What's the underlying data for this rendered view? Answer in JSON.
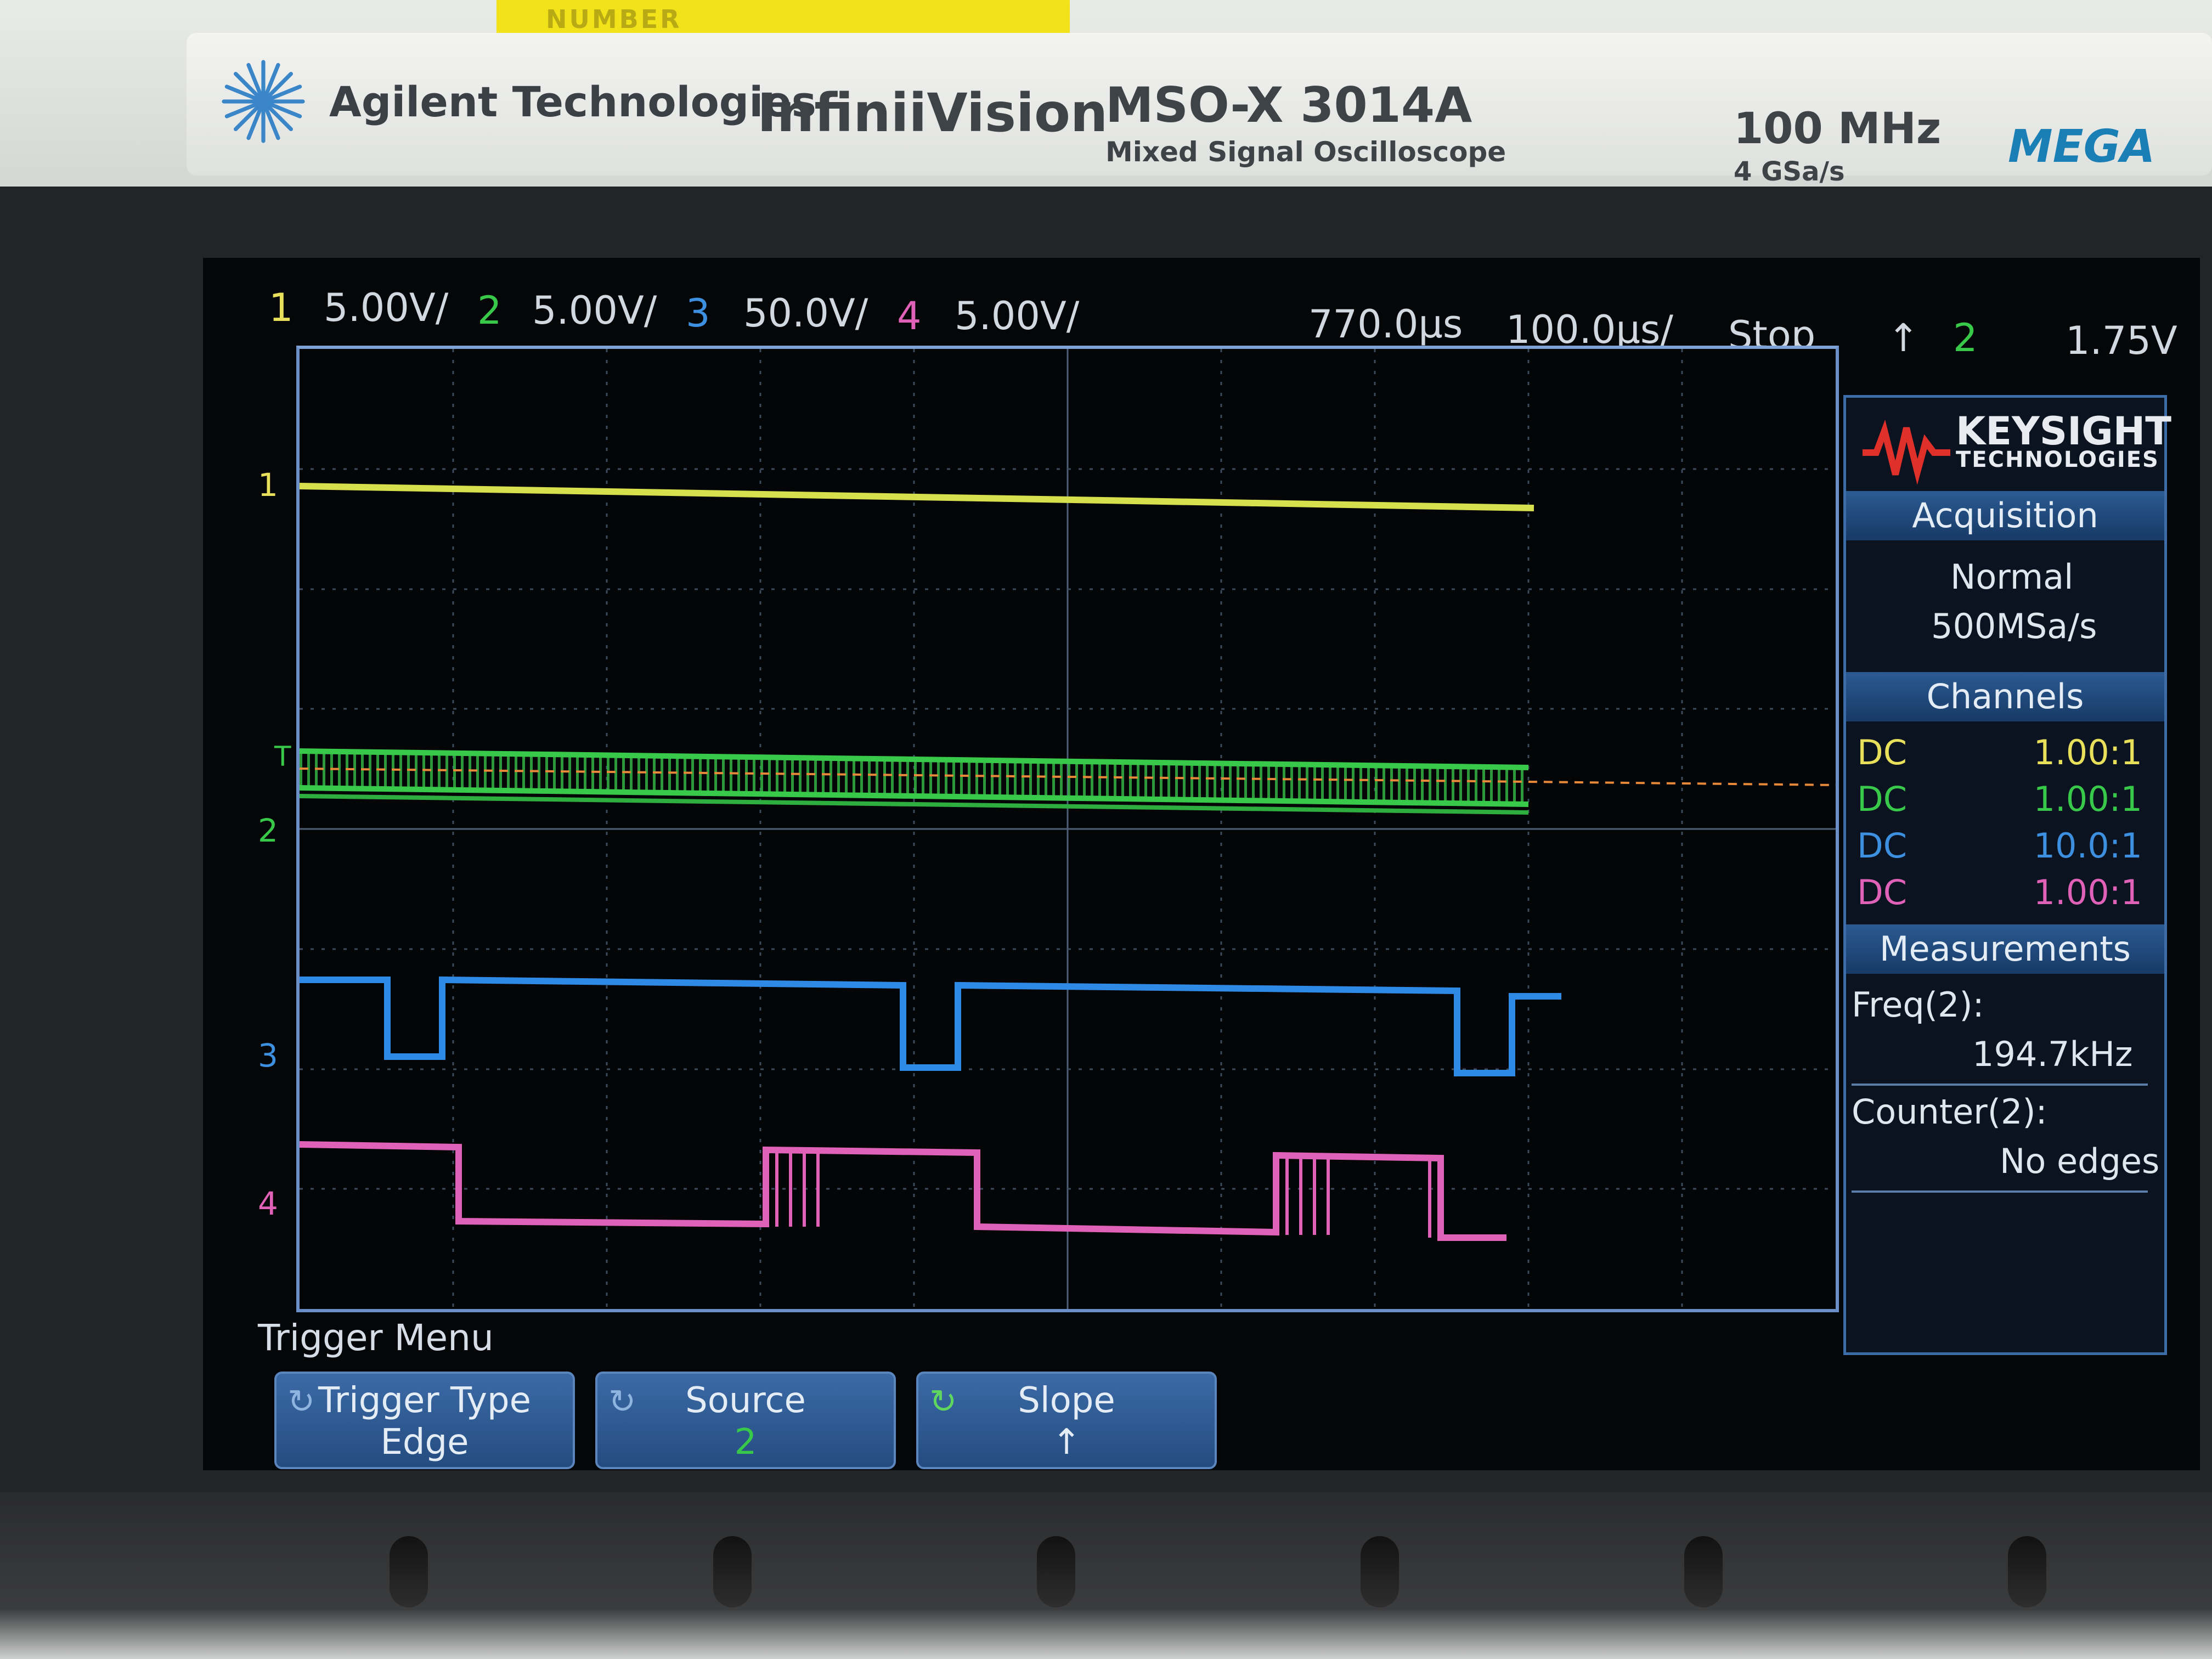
{
  "instrument": {
    "sticker_text": "NUMBER",
    "brand": "Agilent Technologies",
    "series": "InfiniiVision",
    "model": "MSO-X 3014A",
    "model_subtitle": "Mixed Signal Oscilloscope",
    "bandwidth": "100 MHz",
    "sample_rate": "4 GSa/s",
    "badge": "MEGA"
  },
  "status_bar": {
    "channels": [
      {
        "num": "1",
        "scale": "5.00V/",
        "color": "#e8e05a"
      },
      {
        "num": "2",
        "scale": "5.00V/",
        "color": "#39c94a"
      },
      {
        "num": "3",
        "scale": "50.0V/",
        "color": "#3d8fe0"
      },
      {
        "num": "4",
        "scale": "5.00V/",
        "color": "#e061b8"
      }
    ],
    "time_position": "770.0µs",
    "time_scale": "100.0µs/",
    "run_state": "Stop",
    "trigger_source": "2",
    "trigger_level": "1.75V"
  },
  "waveform_markers": {
    "ch1": "1",
    "ch2": "2",
    "ch3": "3",
    "ch4": "4",
    "trigger": "T"
  },
  "side_panel": {
    "logo": "KEYSIGHT",
    "logo_sub": "TECHNOLOGIES",
    "acquisition": {
      "title": "Acquisition",
      "mode": "Normal",
      "rate": "500MSa/s"
    },
    "channels": {
      "title": "Channels",
      "rows": [
        {
          "coupling": "DC",
          "ratio": "1.00:1",
          "color": "#e8e05a"
        },
        {
          "coupling": "DC",
          "ratio": "1.00:1",
          "color": "#39c94a"
        },
        {
          "coupling": "DC",
          "ratio": "10.0:1",
          "color": "#3d8fe0"
        },
        {
          "coupling": "DC",
          "ratio": "1.00:1",
          "color": "#e061b8"
        }
      ]
    },
    "measurements": {
      "title": "Measurements",
      "freq_label": "Freq(2):",
      "freq_value": "194.7kHz",
      "counter_label": "Counter(2):",
      "counter_value": "No edges"
    }
  },
  "softkeys": {
    "menu_title": "Trigger Menu",
    "keys": [
      {
        "label": "Trigger Type",
        "value": "Edge"
      },
      {
        "label": "Source",
        "value": "2"
      },
      {
        "label": "Slope",
        "value": "↑"
      }
    ]
  },
  "colors": {
    "ch1": "#e8e05a",
    "ch2": "#39c94a",
    "ch3": "#3d8fe0",
    "ch4": "#e061b8",
    "trigger_line": "#e8893a",
    "grid": "#3b4a5c",
    "accent": "#2b5a92"
  }
}
